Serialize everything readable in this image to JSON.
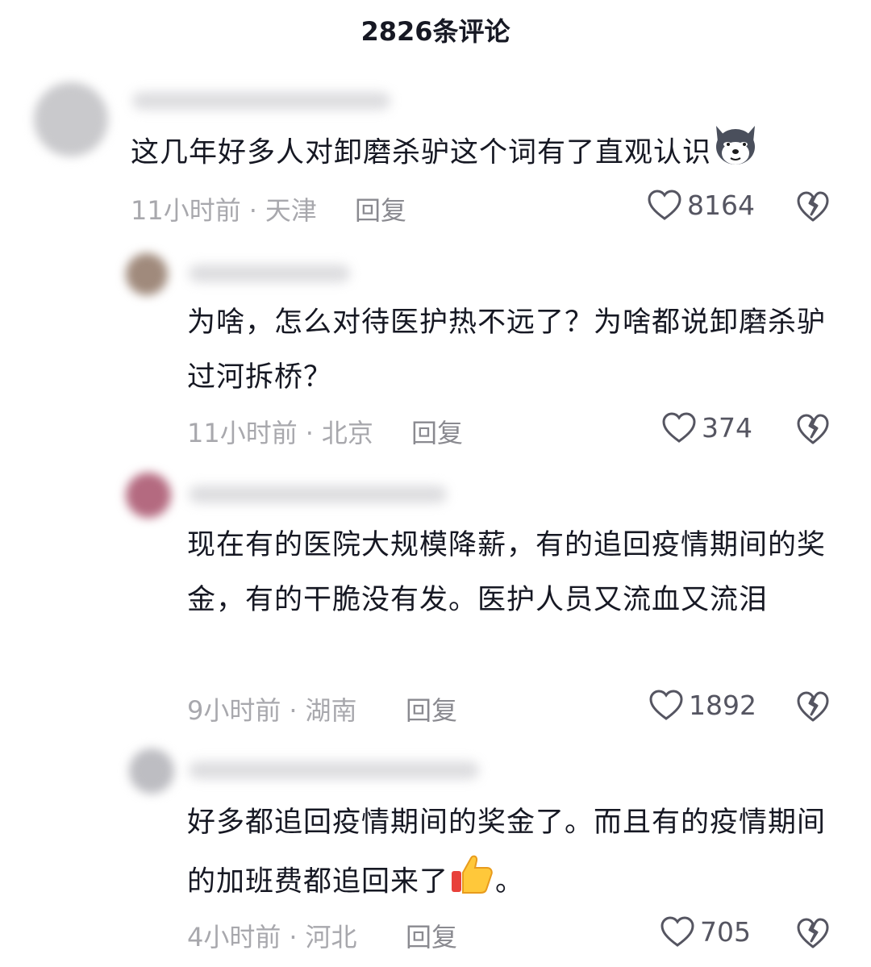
{
  "header": {
    "title": "2826条评论"
  },
  "comments": [
    {
      "text": "这几年好多人对卸磨杀驴这个词有了直观认识",
      "emoji": "husky-emoji",
      "time": "11小时前",
      "location": "天津",
      "reply_label": "回复",
      "likes": "8164"
    },
    {
      "text": "为啥，怎么对待医护热不远了？为啥都说卸磨杀驴过河拆桥？",
      "time": "11小时前",
      "location": "北京",
      "reply_label": "回复",
      "likes": "374"
    },
    {
      "text": "现在有的医院大规模降薪，有的追回疫情期间的奖金，有的干脆没有发。医护人员又流血又流泪",
      "time": "9小时前",
      "location": "湖南",
      "reply_label": "回复",
      "likes": "1892"
    },
    {
      "text": "好多都追回疫情期间的奖金了。而且有的疫情期间的加班费都追回来了",
      "text_suffix": "。",
      "emoji": "thumbs-up-emoji",
      "time": "4小时前",
      "location": "河北",
      "reply_label": "回复",
      "likes": "705"
    }
  ],
  "colors": {
    "text": "#161823",
    "meta": "#a8a8ad",
    "icon": "#555561"
  }
}
